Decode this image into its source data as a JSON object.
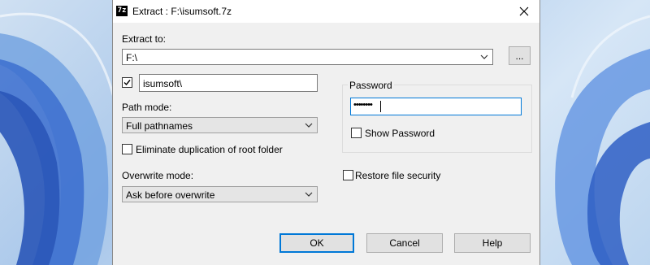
{
  "window": {
    "app_icon_text": "7z",
    "title": "Extract : F:\\isumsoft.7z"
  },
  "extract_to": {
    "label": "Extract to:",
    "value": "F:\\",
    "browse_label": "..."
  },
  "subfolder": {
    "checked": true,
    "value": "isumsoft\\"
  },
  "path_mode": {
    "label": "Path mode:",
    "selected": "Full pathnames"
  },
  "eliminate_duplication": {
    "label": "Eliminate duplication of root folder",
    "checked": false
  },
  "overwrite_mode": {
    "label": "Overwrite mode:",
    "selected": "Ask before overwrite"
  },
  "password": {
    "group_label": "Password",
    "masked_value": "••••••••",
    "show_password_label": "Show Password",
    "show_password_checked": false
  },
  "restore_security": {
    "label": "Restore file security",
    "checked": false
  },
  "buttons": {
    "ok": "OK",
    "cancel": "Cancel",
    "help": "Help"
  },
  "colors": {
    "accent": "#0078d7",
    "dialog_bg": "#f0f0f0"
  }
}
